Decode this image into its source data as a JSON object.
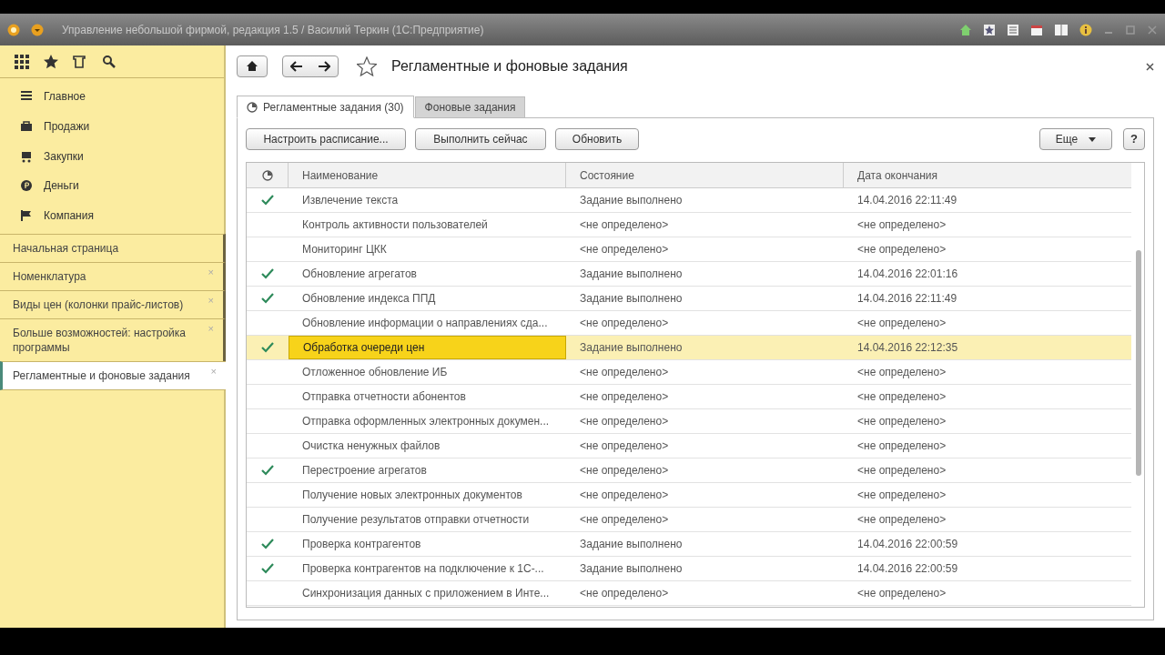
{
  "window": {
    "title": "Управление небольшой фирмой, редакция 1.5 / Василий Теркин  (1С:Предприятие)"
  },
  "sidebar": {
    "sections": [
      {
        "label": "Главное"
      },
      {
        "label": "Продажи"
      },
      {
        "label": "Закупки"
      },
      {
        "label": "Деньги"
      },
      {
        "label": "Компания"
      }
    ],
    "open_windows": [
      {
        "label": "Начальная страница",
        "selected": false
      },
      {
        "label": "Номенклатура",
        "selected": false,
        "close": "×"
      },
      {
        "label": "Виды цен (колонки прайс-листов)",
        "selected": false,
        "close": "×"
      },
      {
        "label": "Больше возможностей: настройка программы",
        "selected": false,
        "close": "×"
      },
      {
        "label": "Регламентные и фоновые задания",
        "selected": true,
        "close": "×"
      }
    ]
  },
  "form": {
    "title": "Регламентные и фоновые задания",
    "tabs": [
      {
        "label": "Регламентные задания (30)",
        "selected": true
      },
      {
        "label": "Фоновые задания",
        "selected": false
      }
    ],
    "buttons": [
      "Настроить расписание...",
      "Выполнить сейчас",
      "Обновить"
    ],
    "more_button": "Еще",
    "help_button": "?",
    "table": {
      "columns": [
        "Наименование",
        "Состояние",
        "Дата окончания"
      ],
      "rows": [
        {
          "done": true,
          "selected": false,
          "name": "Извлечение текста",
          "state": "Задание выполнено",
          "end": "14.04.2016 22:11:49"
        },
        {
          "done": false,
          "selected": false,
          "name": "Контроль активности пользователей",
          "state": "<не определено>",
          "end": "<не определено>"
        },
        {
          "done": false,
          "selected": false,
          "name": "Мониторинг ЦКК",
          "state": "<не определено>",
          "end": "<не определено>"
        },
        {
          "done": true,
          "selected": false,
          "name": "Обновление агрегатов",
          "state": "Задание выполнено",
          "end": "14.04.2016 22:01:16"
        },
        {
          "done": true,
          "selected": false,
          "name": "Обновление индекса ППД",
          "state": "Задание выполнено",
          "end": "14.04.2016 22:11:49"
        },
        {
          "done": false,
          "selected": false,
          "name": "Обновление информации о направлениях сда...",
          "state": "<не определено>",
          "end": "<не определено>"
        },
        {
          "done": true,
          "selected": true,
          "name": "Обработка очереди цен",
          "state": "Задание выполнено",
          "end": "14.04.2016 22:12:35"
        },
        {
          "done": false,
          "selected": false,
          "name": "Отложенное обновление ИБ",
          "state": "<не определено>",
          "end": "<не определено>"
        },
        {
          "done": false,
          "selected": false,
          "name": "Отправка отчетности абонентов",
          "state": "<не определено>",
          "end": "<не определено>"
        },
        {
          "done": false,
          "selected": false,
          "name": "Отправка оформленных электронных докумен...",
          "state": "<не определено>",
          "end": "<не определено>"
        },
        {
          "done": false,
          "selected": false,
          "name": "Очистка ненужных файлов",
          "state": "<не определено>",
          "end": "<не определено>"
        },
        {
          "done": true,
          "selected": false,
          "name": "Перестроение агрегатов",
          "state": "<не определено>",
          "end": "<не определено>"
        },
        {
          "done": false,
          "selected": false,
          "name": "Получение новых электронных документов",
          "state": "<не определено>",
          "end": "<не определено>"
        },
        {
          "done": false,
          "selected": false,
          "name": "Получение результатов отправки отчетности",
          "state": "<не определено>",
          "end": "<не определено>"
        },
        {
          "done": true,
          "selected": false,
          "name": "Проверка контрагентов",
          "state": "Задание выполнено",
          "end": "14.04.2016 22:00:59"
        },
        {
          "done": true,
          "selected": false,
          "name": "Проверка контрагентов на подключение к 1С-...",
          "state": "Задание выполнено",
          "end": "14.04.2016 22:00:59"
        },
        {
          "done": false,
          "selected": false,
          "name": "Синхронизация данных с приложением в Инте...",
          "state": "<не определено>",
          "end": "<не определено>"
        }
      ]
    }
  }
}
